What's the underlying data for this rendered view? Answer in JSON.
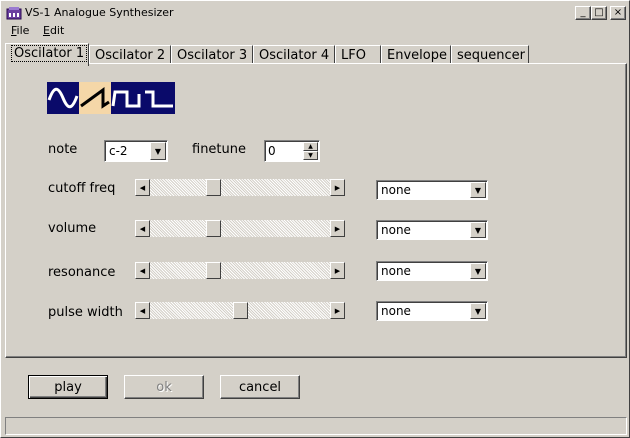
{
  "window": {
    "title": "VS-1 Analogue Synthesizer",
    "controls": {
      "minimize": "_",
      "maximize": "□",
      "close": "×"
    }
  },
  "menu": [
    {
      "label": "File",
      "mnemonic": "F",
      "rest": "ile"
    },
    {
      "label": "Edit",
      "mnemonic": "E",
      "rest": "dit"
    }
  ],
  "tabs": [
    {
      "label": "Oscilator 1",
      "active": true
    },
    {
      "label": "Oscilator 2",
      "active": false
    },
    {
      "label": "Oscilator 3",
      "active": false
    },
    {
      "label": "Oscilator 4",
      "active": false
    },
    {
      "label": "LFO",
      "active": false
    },
    {
      "label": "Envelope",
      "active": false
    },
    {
      "label": "sequencer",
      "active": false
    }
  ],
  "waveforms": {
    "options": [
      "sine-wave-icon",
      "sawtooth-wave-icon",
      "square-wave-icon",
      "pulse-wave-icon"
    ],
    "selected_index": 1,
    "colors": {
      "background": "#0a0a6a",
      "selected_background": "#f5d7a8",
      "stroke": "#ffffff",
      "selected_stroke": "#000000"
    }
  },
  "note": {
    "label": "note",
    "value": "c-2"
  },
  "finetune": {
    "label": "finetune",
    "value": "0"
  },
  "params": [
    {
      "label": "cutoff freq",
      "level_fraction": 0.34,
      "modulation": "none"
    },
    {
      "label": "volume",
      "level_fraction": 0.34,
      "modulation": "none"
    },
    {
      "label": "resonance",
      "level_fraction": 0.34,
      "modulation": "none"
    },
    {
      "label": "pulse width",
      "level_fraction": 0.5,
      "modulation": "none"
    }
  ],
  "buttons": {
    "play": "play",
    "ok": "ok",
    "cancel": "cancel"
  },
  "status": ""
}
